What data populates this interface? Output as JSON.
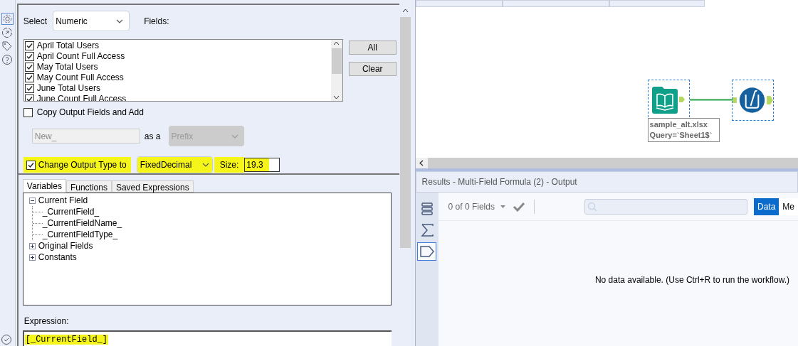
{
  "config": {
    "select": {
      "label": "Select",
      "value": "Numeric"
    },
    "fields_label": "Fields:",
    "fields": [
      {
        "label": "April Total Users",
        "checked": true
      },
      {
        "label": "April Count Full Access",
        "checked": true
      },
      {
        "label": "May Total Users",
        "checked": true
      },
      {
        "label": "May Count Full Access",
        "checked": true
      },
      {
        "label": "June Total Users",
        "checked": true
      },
      {
        "label": "June Count Full Access",
        "checked": true
      }
    ],
    "buttons": [
      "All",
      "Clear"
    ],
    "copy_output": {
      "label": "Copy Output Fields and Add",
      "checked": false
    },
    "prefix_field": {
      "value": "New_",
      "disabled": true
    },
    "as_a": "as a",
    "position_select": {
      "value": "Prefix",
      "disabled": true
    },
    "change_type": {
      "label": "Change Output Type to",
      "checked": true,
      "type_value": "FixedDecimal",
      "size_label": "Size:",
      "size_value": "19.3",
      "highlighted": true
    },
    "tabs": [
      {
        "label": "Variables",
        "selected": true
      },
      {
        "label": "Functions",
        "selected": false
      },
      {
        "label": "Saved Expressions",
        "selected": false
      }
    ],
    "tree": [
      {
        "label": "Current Field",
        "expanded": true,
        "children": [
          {
            "label": "_CurrentField_"
          },
          {
            "label": "_CurrentFieldName_"
          },
          {
            "label": "_CurrentFieldType_"
          }
        ]
      },
      {
        "label": "Original Fields",
        "expanded": false
      },
      {
        "label": "Constants",
        "expanded": false
      }
    ],
    "expression_label": "Expression:",
    "expression": {
      "value": "[_CurrentField_]",
      "highlighted": true
    }
  },
  "canvas": {
    "annotation": [
      "sample_alt.xlsx",
      "Query=`Sheet1$`"
    ]
  },
  "results": {
    "title": "Results - Multi-Field Formula (2) - Output",
    "fields_count": "0 of 0 Fields",
    "side_tools": [
      {
        "kind": "list",
        "selected": false
      },
      {
        "kind": "sum",
        "selected": false
      },
      {
        "kind": "tag",
        "selected": true
      }
    ],
    "view_tabs": [
      {
        "label": "Data",
        "selected": true
      },
      {
        "label": "Me",
        "selected": false
      }
    ],
    "empty_message": "No data available. (Use Ctrl+R to run the workflow.)"
  }
}
